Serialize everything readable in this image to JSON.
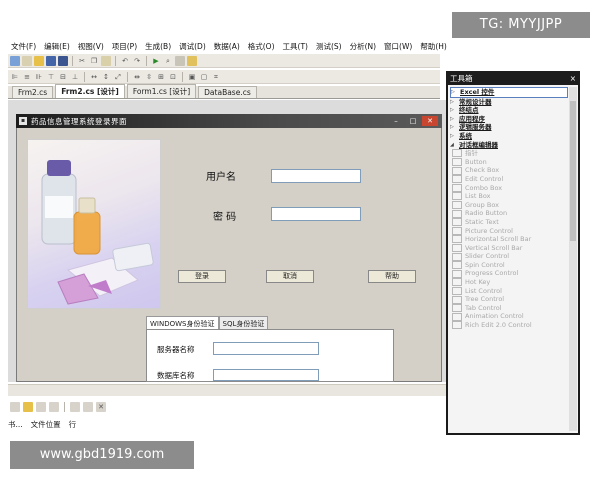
{
  "watermark_top": "TG: MYYJJPP",
  "watermark_bottom": "www.gbd1919.com",
  "menu": [
    "文件(F)",
    "编辑(E)",
    "视图(V)",
    "项目(P)",
    "生成(B)",
    "调试(D)",
    "数据(A)",
    "格式(O)",
    "工具(T)",
    "测试(S)",
    "分析(N)",
    "窗口(W)",
    "帮助(H)"
  ],
  "doc_tabs": [
    {
      "label": "Frm2.cs",
      "active": false
    },
    {
      "label": "Frm2.cs [设计]",
      "active": true
    },
    {
      "label": "Form1.cs [设计]",
      "active": false
    },
    {
      "label": "DataBase.cs",
      "active": false
    }
  ],
  "form": {
    "title": "药品信息管理系统登录界面",
    "username_label": "用户名",
    "password_label": "密 码",
    "login_button": "登录",
    "cancel_button": "取消",
    "help_button": "帮助",
    "tabs": [
      {
        "label": "WINDOWS身份验证",
        "active": true
      },
      {
        "label": "SQL身份验证",
        "active": false
      }
    ],
    "server_label": "服务器名称",
    "database_label": "数据库名称"
  },
  "toolbox": {
    "title": "工具箱",
    "close": "×",
    "categories": [
      {
        "label": "Excel 控件",
        "highlight": true
      },
      {
        "label": "常规设计器",
        "highlight": false
      },
      {
        "label": "终结点",
        "highlight": false
      },
      {
        "label": "应用程序",
        "highlight": false
      },
      {
        "label": "逻辑服务器",
        "highlight": false
      },
      {
        "label": "系统",
        "highlight": false
      },
      {
        "label": "对话框编辑器",
        "highlight": false,
        "expanded": true
      }
    ],
    "items": [
      "指针",
      "Button",
      "Check Box",
      "Edit Control",
      "Combo Box",
      "List Box",
      "Group Box",
      "Radio Button",
      "Static Text",
      "Picture Control",
      "Horizontal Scroll Bar",
      "Vertical Scroll Bar",
      "Slider Control",
      "Spin Control",
      "Progress Control",
      "Hot Key",
      "List Control",
      "Tree Control",
      "Tab Control",
      "Animation Control",
      "Rich Edit 2.0 Control"
    ]
  },
  "status": {
    "items": [
      "书...",
      "文件位置",
      "行"
    ]
  }
}
